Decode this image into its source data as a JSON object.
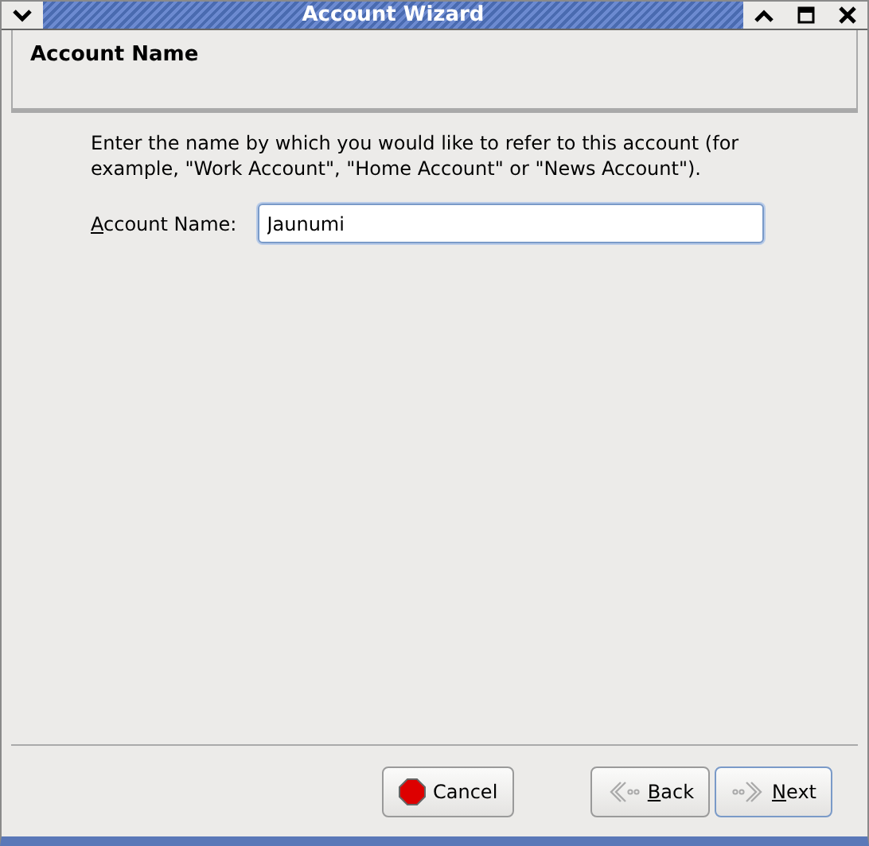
{
  "window": {
    "title": "Account Wizard"
  },
  "page": {
    "title": "Account Name",
    "description": "Enter the name by which you would like to refer to this account (for example, \"Work Account\", \"Home Account\" or \"News Account\")."
  },
  "field": {
    "label": "Account Name:",
    "mnemonic": true,
    "value": "Jaunumi",
    "focused": true
  },
  "buttons": [
    {
      "kind": "cancel",
      "label": "Cancel",
      "mnemonic": false,
      "focused": false
    },
    {
      "kind": "back",
      "label": "Back",
      "mnemonic": true,
      "focused": false
    },
    {
      "kind": "next",
      "label": "Next",
      "mnemonic": true,
      "focused": true
    }
  ]
}
